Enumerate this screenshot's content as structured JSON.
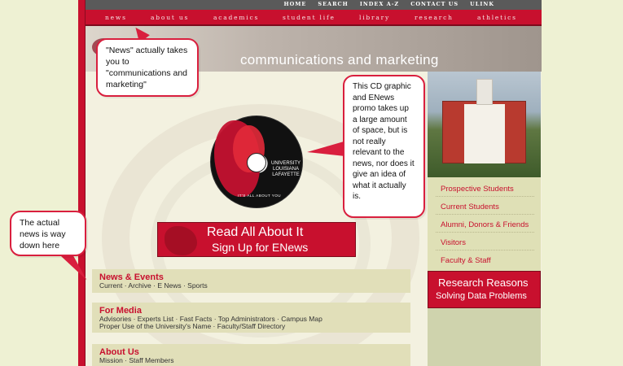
{
  "top_links": [
    "HOME",
    "SEARCH",
    "INDEX A-Z",
    "CONTACT US",
    "ULINK"
  ],
  "nav_items": [
    "news",
    "about us",
    "academics",
    "student life",
    "library",
    "research",
    "athletics"
  ],
  "banner_title": "communications and marketing",
  "cd": {
    "brand_line1": "UNIVERSITY",
    "brand_line2": "LOUISIANA",
    "brand_line3": "LAFAYETTE",
    "tagline": "IT'S ALL ABOUT YOU"
  },
  "enews_promo": {
    "line1": "Read All About It",
    "line2": "Sign Up for ENews"
  },
  "content_blocks": [
    {
      "title": "News & Events",
      "lines": [
        "Current · Archive · E News · Sports"
      ]
    },
    {
      "title": "For Media",
      "lines": [
        "Advisories · Experts List · Fast Facts · Top Administrators · Campus Map",
        "Proper Use of the University's Name · Faculty/Staff Directory"
      ]
    },
    {
      "title": "About Us",
      "lines": [
        "Mission · Staff Members"
      ]
    }
  ],
  "audience_links": [
    "Prospective Students",
    "Current Students",
    "Alumni, Donors & Friends",
    "Visitors",
    "Faculty & Staff"
  ],
  "research_banner": {
    "line1": "Research Reasons",
    "line2": "Solving Data Problems"
  },
  "annotations": {
    "news": "\"News\" actually takes you to \"communications and marketing\"",
    "cd": "This CD graphic and ENews promo takes up a large amount of space, but is not really relevant to the news, nor does it give an idea of what it actually is.",
    "actual_news": "The actual news is way down here"
  },
  "colors": {
    "brand_red": "#c8102e",
    "page_bg": "#eef1d3",
    "content_bg": "#f3f1e0",
    "block_bg": "#e1dfb9"
  }
}
